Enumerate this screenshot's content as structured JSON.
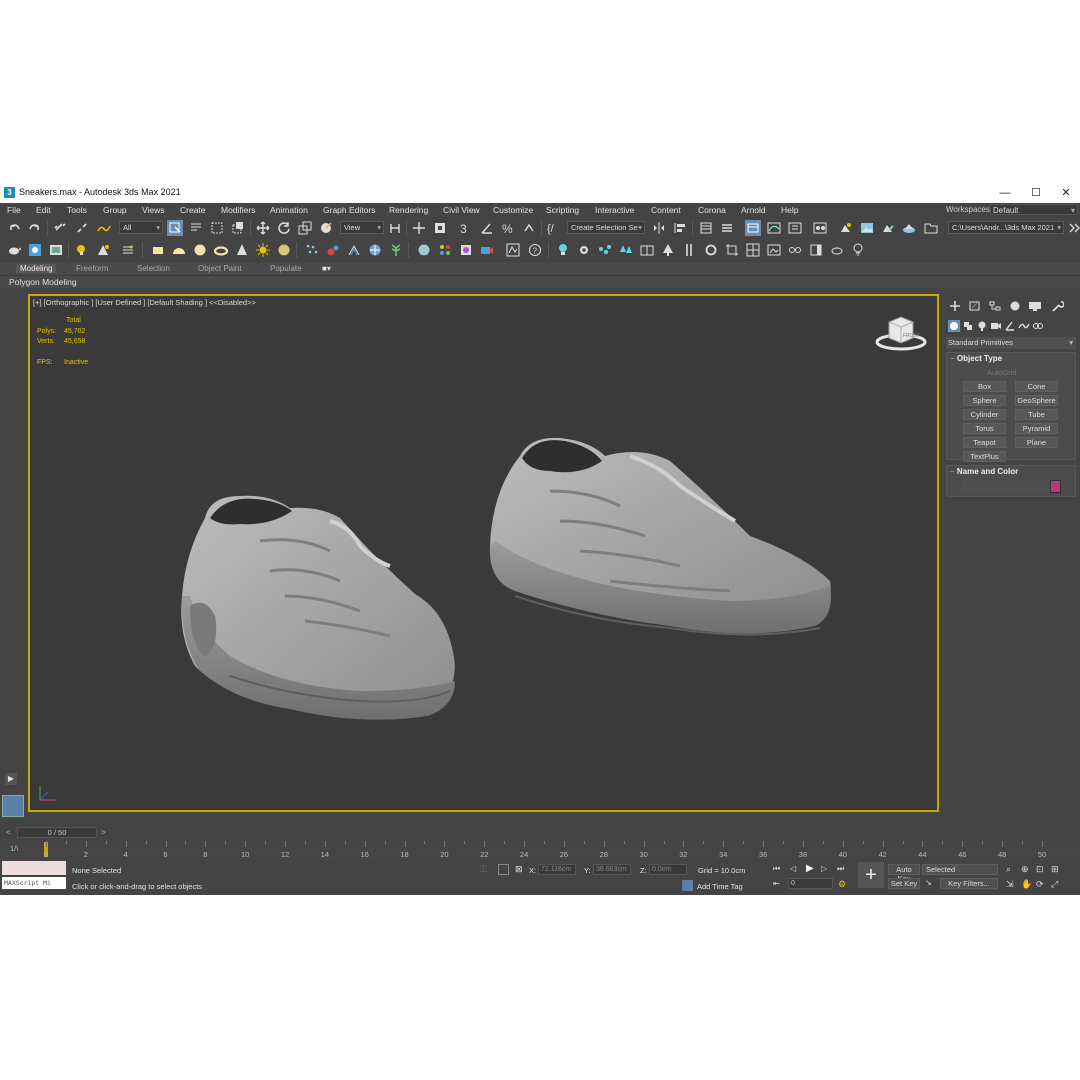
{
  "window": {
    "title": "Sneakers.max - Autodesk 3ds Max 2021",
    "icon_letter": "3",
    "minimize": "—",
    "maximize": "☐",
    "close": "✕"
  },
  "menu": [
    "File",
    "Edit",
    "Tools",
    "Group",
    "Views",
    "Create",
    "Modifiers",
    "Animation",
    "Graph Editors",
    "Rendering",
    "Civil View",
    "Customize",
    "Scripting",
    "Interactive",
    "Content",
    "Corona",
    "Arnold",
    "Help"
  ],
  "workspaces": {
    "label": "Workspaces:",
    "value": "Default"
  },
  "toolbar": {
    "selection_filter": "All",
    "ref_coord": "View",
    "named_selection": "Create Selection Se",
    "project_path": "C:\\Users\\Andr...\\3ds Max 2021"
  },
  "ribbon": {
    "tabs": [
      "Modeling",
      "Freeform",
      "Selection",
      "Object Paint",
      "Populate"
    ],
    "active": "Modeling",
    "sub_label": "Polygon Modeling"
  },
  "viewport": {
    "label": "[+] [Orthographic ] [User Defined ] [Default Shading ] <<Disabled>>",
    "stats": {
      "header": "Total",
      "polys_label": "Polys:",
      "polys": "45,702",
      "verts_label": "Verts:",
      "verts": "45,658",
      "fps_label": "FPS:",
      "fps": "Inactive"
    },
    "viewcube_label": "FRONT"
  },
  "command_panel": {
    "category": "Standard Primitives",
    "object_type": {
      "title": "Object Type",
      "autogrid": "AutoGrid",
      "buttons": [
        "Box",
        "Cone",
        "Sphere",
        "GeoSphere",
        "Cylinder",
        "Tube",
        "Torus",
        "Pyramid",
        "Teapot",
        "Plane",
        "TextPlus"
      ]
    },
    "name_color": {
      "title": "Name and Color",
      "swatch": "#c2337a"
    }
  },
  "timeline": {
    "slider": "0 / 50",
    "ticks": [
      "0",
      "2",
      "4",
      "6",
      "8",
      "10",
      "12",
      "14",
      "16",
      "18",
      "20",
      "22",
      "24",
      "26",
      "28",
      "30",
      "32",
      "34",
      "36",
      "38",
      "40",
      "42",
      "44",
      "46",
      "48",
      "50"
    ],
    "mini_icon": "1/\\"
  },
  "status": {
    "maxscript": "MAXScript Mi",
    "selection": "None Selected",
    "prompt": "Click or click-and-drag to select objects",
    "x_label": "X:",
    "x": "72.116cm",
    "y_label": "Y:",
    "y": "36.663cm",
    "z_label": "Z:",
    "z": "0.0cm",
    "grid": "Grid = 10.0cm",
    "add_time_tag": "Add Time Tag",
    "auto_key": "Auto Key",
    "set_key": "Set Key",
    "key_set": "Selected",
    "key_filters": "Key Filters...",
    "frame": "0"
  }
}
